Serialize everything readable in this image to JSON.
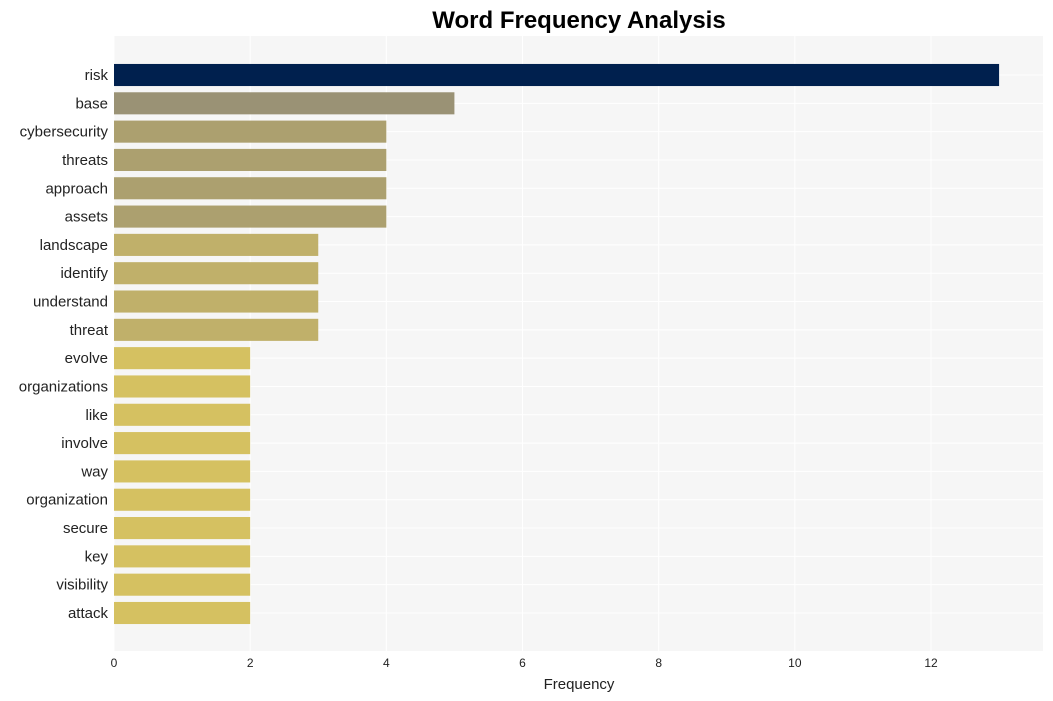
{
  "chart_data": {
    "type": "bar",
    "orientation": "horizontal",
    "title": "Word Frequency Analysis",
    "xlabel": "Frequency",
    "ylabel": "",
    "xlim": [
      0,
      13.6
    ],
    "xticks": [
      0,
      2,
      4,
      6,
      8,
      10,
      12
    ],
    "grid": true,
    "categories": [
      "risk",
      "base",
      "cybersecurity",
      "threats",
      "approach",
      "assets",
      "landscape",
      "identify",
      "understand",
      "threat",
      "evolve",
      "organizations",
      "like",
      "involve",
      "way",
      "organization",
      "secure",
      "key",
      "visibility",
      "attack"
    ],
    "values": [
      13,
      5,
      4,
      4,
      4,
      4,
      3,
      3,
      3,
      3,
      2,
      2,
      2,
      2,
      2,
      2,
      2,
      2,
      2,
      2
    ],
    "colors": {
      "13": "#00204e",
      "5": "#9a9275",
      "4": "#aca06f",
      "3": "#c0b06a",
      "2": "#d5c161"
    },
    "plot_background": "#f6f6f6"
  }
}
